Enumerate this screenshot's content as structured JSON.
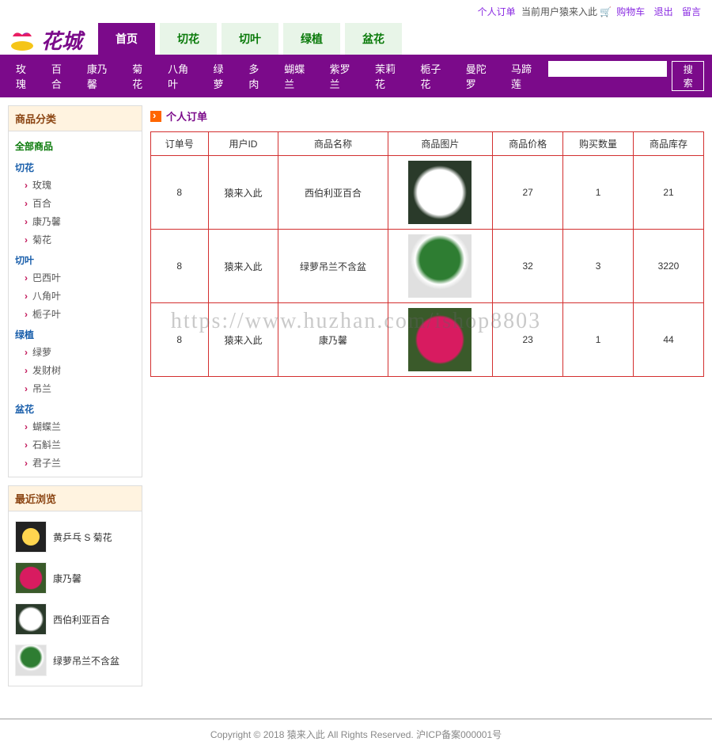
{
  "topbar": {
    "personal_order": "个人订单",
    "current_user_prefix": "当前用户",
    "current_user": "猿来入此",
    "cart": "购物车",
    "logout": "退出",
    "message": "留言"
  },
  "logo_text": "花城",
  "nav_tabs": [
    "首页",
    "切花",
    "切叶",
    "绿植",
    "盆花"
  ],
  "purple_nav": [
    "玫瑰",
    "百合",
    "康乃馨",
    "菊花",
    "八角叶",
    "绿萝",
    "多肉",
    "蝴蝶兰",
    "紫罗兰",
    "茉莉花",
    "栀子花",
    "曼陀罗",
    "马蹄莲"
  ],
  "search_btn": "搜索",
  "sidebar": {
    "cat_title": "商品分类",
    "all": "全部商品",
    "groups": [
      {
        "name": "切花",
        "items": [
          "玫瑰",
          "百合",
          "康乃馨",
          "菊花"
        ]
      },
      {
        "name": "切叶",
        "items": [
          "巴西叶",
          "八角叶",
          "栀子叶"
        ]
      },
      {
        "name": "绿植",
        "items": [
          "绿萝",
          "发财树",
          "吊兰"
        ]
      },
      {
        "name": "盆花",
        "items": [
          "蝴蝶兰",
          "石斛兰",
          "君子兰"
        ]
      }
    ],
    "recent_title": "最近浏览",
    "recent": [
      {
        "name": "黄乒乓 S 菊花",
        "thumb": "thumb-yellow"
      },
      {
        "name": "康乃馨",
        "thumb": "thumb-pink"
      },
      {
        "name": "西伯利亚百合",
        "thumb": "thumb-white"
      },
      {
        "name": "绿萝吊兰不含盆",
        "thumb": "thumb-green"
      }
    ]
  },
  "page_title": "个人订单",
  "table": {
    "headers": [
      "订单号",
      "用户ID",
      "商品名称",
      "商品图片",
      "商品价格",
      "购买数量",
      "商品库存"
    ],
    "rows": [
      {
        "order_no": "8",
        "user": "猿来入此",
        "name": "西伯利亚百合",
        "thumb": "thumb-white",
        "price": "27",
        "qty": "1",
        "stock": "21"
      },
      {
        "order_no": "8",
        "user": "猿来入此",
        "name": "绿萝吊兰不含盆",
        "thumb": "thumb-green",
        "price": "32",
        "qty": "3",
        "stock": "3220"
      },
      {
        "order_no": "8",
        "user": "猿来入此",
        "name": "康乃馨",
        "thumb": "thumb-pink",
        "price": "23",
        "qty": "1",
        "stock": "44"
      }
    ]
  },
  "watermark": "https://www.huzhan.com/ishop8803",
  "footer": "Copyright © 2018 猿来入此 All Rights Reserved. 沪ICP备案000001号"
}
